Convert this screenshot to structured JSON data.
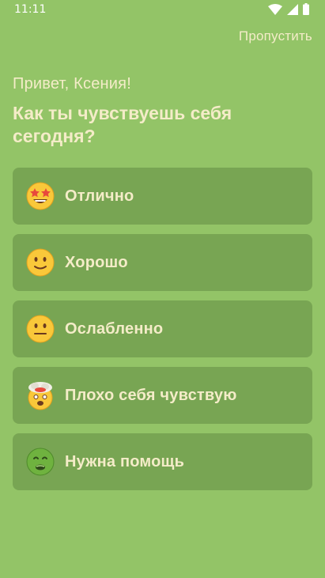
{
  "status_bar": {
    "time": "11:11",
    "icons": [
      "wifi-icon",
      "signal-icon",
      "battery-icon"
    ]
  },
  "header": {
    "skip_label": "Пропустить"
  },
  "main": {
    "greeting": "Привет, Ксения!",
    "question": "Как ты чувствуешь себя сегодня?",
    "options": [
      {
        "label": "Отлично",
        "emoji": "star-struck-emoji"
      },
      {
        "label": "Хорошо",
        "emoji": "slight-smile-emoji"
      },
      {
        "label": "Ослабленно",
        "emoji": "neutral-face-emoji"
      },
      {
        "label": "Плохо себя чувствую",
        "emoji": "exploding-head-emoji"
      },
      {
        "label": "Нужна помощь",
        "emoji": "nauseated-face-emoji"
      }
    ]
  },
  "colors": {
    "background": "#93c467",
    "card": "#78a553",
    "text": "#f4ecc8"
  }
}
